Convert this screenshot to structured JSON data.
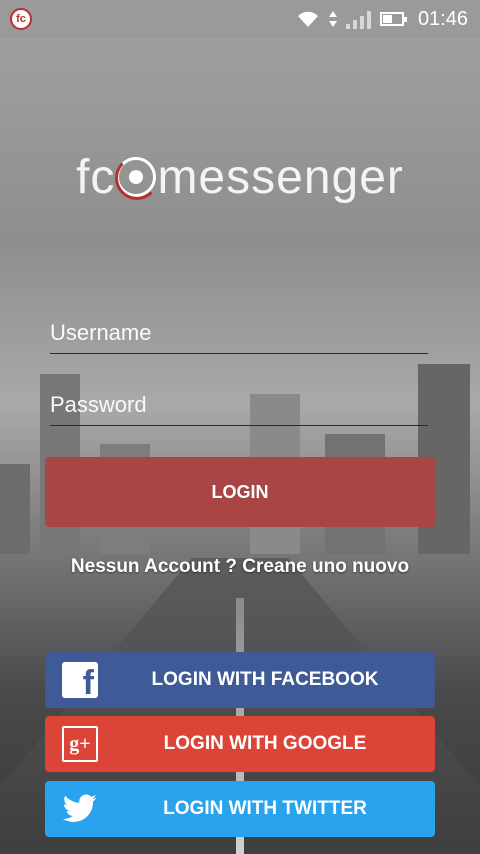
{
  "status_bar": {
    "app_icon_text": "fc",
    "time": "01:46"
  },
  "logo": {
    "part1": "fc",
    "part2": "messenger"
  },
  "form": {
    "username_placeholder": "Username",
    "password_placeholder": "Password"
  },
  "login_button": "LOGIN",
  "signup_text": "Nessun Account ? Creane uno nuovo",
  "social": {
    "facebook_label": "LOGIN WITH FACEBOOK",
    "google_label": "LOGIN WITH GOOGLE",
    "twitter_label": "LOGIN WITH TWITTER",
    "facebook_color": "#3e5b97",
    "google_color": "#db4437",
    "twitter_color": "#2aa3ef"
  },
  "accent_color": "#a94545",
  "icons": [
    "app-logo-icon",
    "wifi-icon",
    "data-arrows-icon",
    "signal-icon",
    "battery-icon",
    "facebook-icon",
    "google-plus-icon",
    "twitter-icon"
  ]
}
